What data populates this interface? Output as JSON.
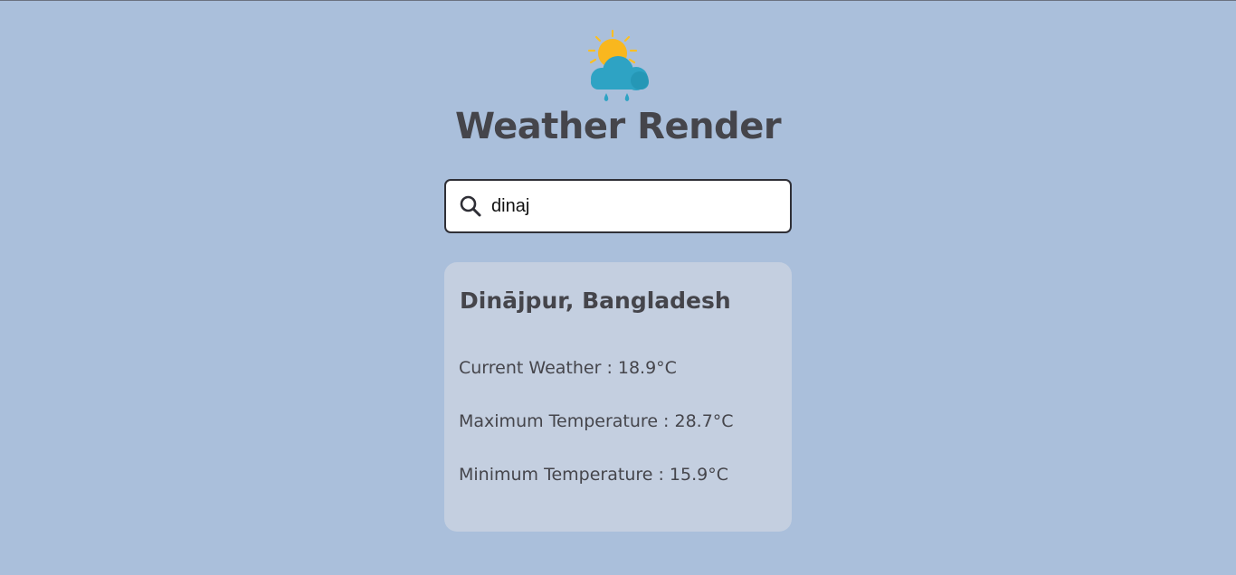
{
  "app": {
    "title": "Weather Render",
    "logo_icon": "sun-cloud-rain-icon"
  },
  "search": {
    "value": "dinaj",
    "icon": "search-icon"
  },
  "result": {
    "location": "Dinājpur, Bangladesh",
    "current_weather": "Current Weather : 18.9°C",
    "max_temperature": "Maximum Temperature : 28.7°C",
    "min_temperature": "Minimum Temperature : 15.9°C"
  },
  "colors": {
    "background": "#aabfdb",
    "card": "#c4cfe0",
    "text": "#45454b",
    "sun": "#fbbf24",
    "cloud": "#2ea3c4",
    "rain": "#2ea3c4"
  }
}
